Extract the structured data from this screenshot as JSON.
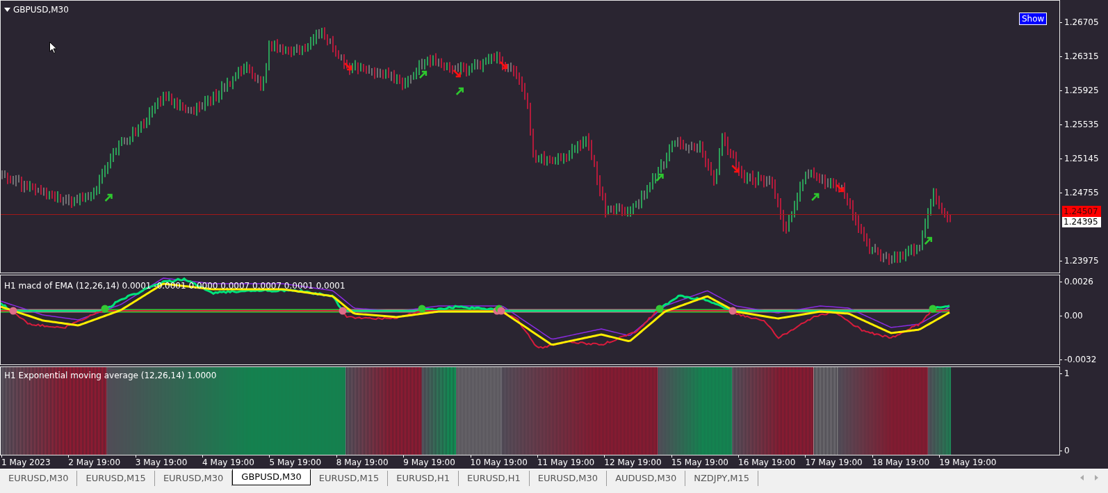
{
  "chart": {
    "title": "GBPUSD,M30",
    "show_button": "Show",
    "price_axis": [
      "1.26705",
      "1.26315",
      "1.25925",
      "1.25535",
      "1.25145",
      "1.24755",
      "1.23975"
    ],
    "bid_label": "1.24507",
    "ask_label": "1.24395"
  },
  "macd": {
    "label": "H1 macd of EMA (12,26,14) 0.0001 -0.0001 0.0000 0.0007 0.0007 0.0001 0.0001",
    "axis": [
      "0.0026",
      "0.00",
      "-0.0032"
    ]
  },
  "ema": {
    "label": "H1 Exponential moving average (12,26,14) 1.0000",
    "axis": [
      "1",
      "0"
    ]
  },
  "time_axis": [
    "1 May 2023",
    "2 May 19:00",
    "3 May 19:00",
    "4 May 19:00",
    "5 May 19:00",
    "8 May 19:00",
    "9 May 19:00",
    "10 May 19:00",
    "11 May 19:00",
    "12 May 19:00",
    "15 May 19:00",
    "16 May 19:00",
    "17 May 19:00",
    "18 May 19:00",
    "19 May 19:00"
  ],
  "tabs": [
    {
      "label": "EURUSD,M30",
      "selected": false
    },
    {
      "label": "EURUSD,M15",
      "selected": false
    },
    {
      "label": "EURUSD,M30",
      "selected": false
    },
    {
      "label": "GBPUSD,M30",
      "selected": true
    },
    {
      "label": "EURUSD,M15",
      "selected": false
    },
    {
      "label": "EURUSD,H1",
      "selected": false
    },
    {
      "label": "EURUSD,H1",
      "selected": false
    },
    {
      "label": "EURUSD,M30",
      "selected": false
    },
    {
      "label": "AUDUSD,M30",
      "selected": false
    },
    {
      "label": "NZDJPY,M15",
      "selected": false
    }
  ]
}
